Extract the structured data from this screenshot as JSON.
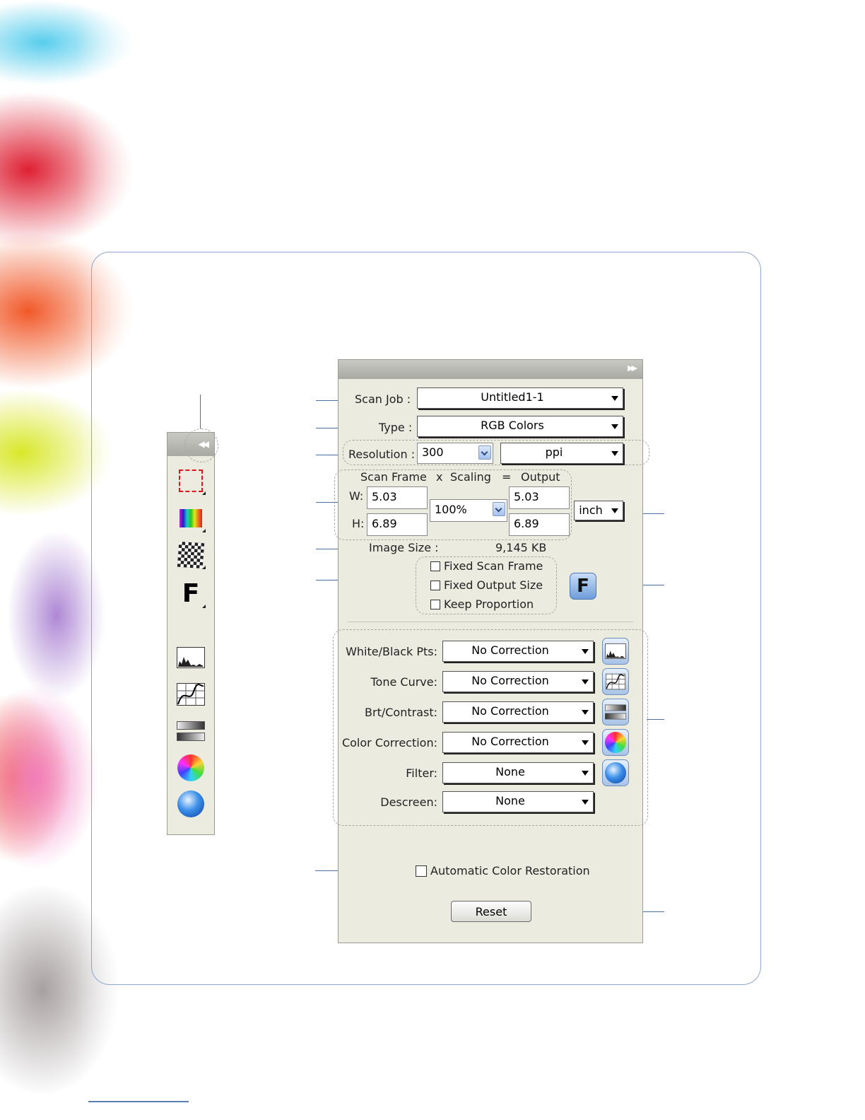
{
  "panel": {
    "scan_job_label": "Scan Job :",
    "scan_job_value": "Untitled1-1",
    "type_label": "Type :",
    "type_value": "RGB Colors",
    "resolution_label": "Resolution :",
    "resolution_value": "300",
    "resolution_unit": "ppi",
    "size_header": {
      "scan_frame": "Scan Frame",
      "x": "x",
      "scaling": "Scaling",
      "eq": "=",
      "output": "Output"
    },
    "w_label": "W:",
    "h_label": "H:",
    "scan_w": "5.03",
    "scan_h": "6.89",
    "scaling": "100%",
    "out_w": "5.03",
    "out_h": "6.89",
    "size_unit": "inch",
    "image_size_label": "Image Size :",
    "image_size_value": "9,145 KB",
    "fixed_scan_frame": "Fixed Scan Frame",
    "fixed_output_size": "Fixed Output Size",
    "keep_proportion": "Keep Proportion",
    "f_button": "F",
    "corrections": [
      {
        "label": "White/Black Pts:",
        "value": "No Correction",
        "icon": "histogram-icon"
      },
      {
        "label": "Tone Curve:",
        "value": "No Correction",
        "icon": "tone-curve-icon"
      },
      {
        "label": "Brt/Contrast:",
        "value": "No Correction",
        "icon": "brightness-contrast-icon"
      },
      {
        "label": "Color Correction:",
        "value": "No Correction",
        "icon": "color-wheel-icon"
      },
      {
        "label": "Filter:",
        "value": "None",
        "icon": "filter-sphere-icon"
      },
      {
        "label": "Descreen:",
        "value": "None"
      }
    ],
    "auto_color_restoration": "Automatic Color Restoration",
    "reset": "Reset"
  },
  "toolbar": {
    "icons": [
      "scan-frame-icon",
      "color-bars-icon",
      "checker-pattern-icon",
      "f-icon",
      "histogram-icon",
      "tone-curve-icon",
      "brightness-contrast-icon",
      "color-wheel-icon",
      "filter-sphere-icon"
    ],
    "f_icon_text": "F"
  },
  "colors": {
    "panel_bg": "#ecebe0",
    "title_bar": "#a9a9a4",
    "frame_border": "#8ea6c8",
    "leader_line": "#4b6e9b",
    "button_blue": "#6e9dd9"
  }
}
